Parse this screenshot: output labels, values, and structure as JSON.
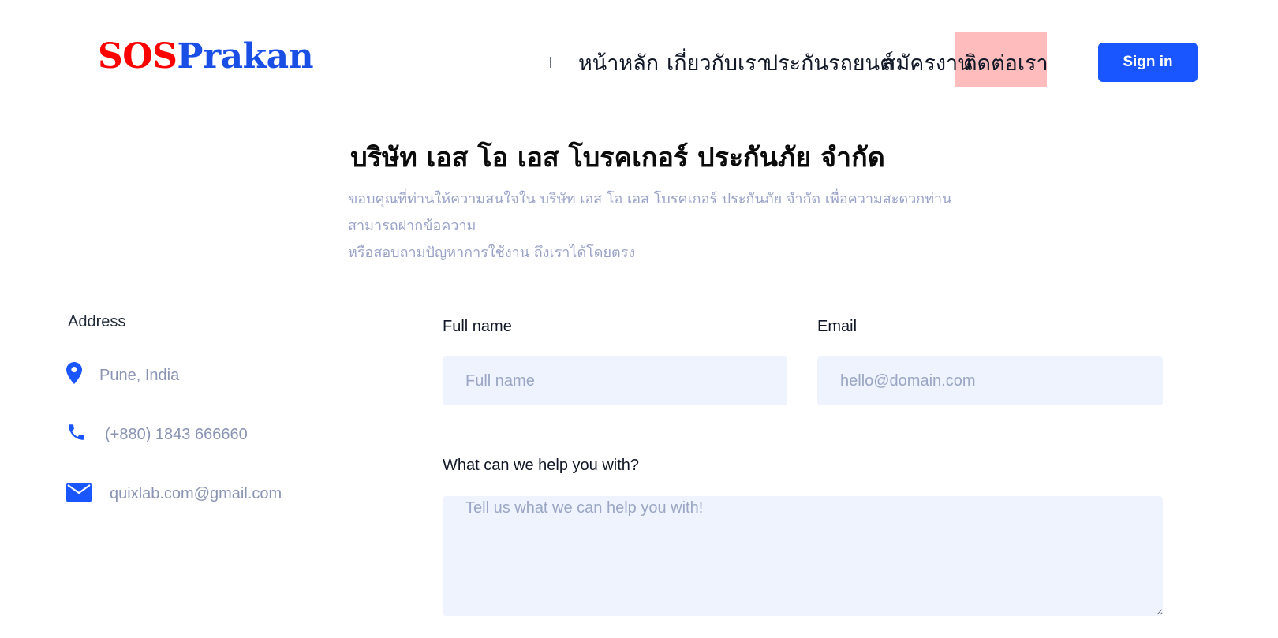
{
  "brand": {
    "part1": "SOS",
    "part2": "Prakan",
    "colors": {
      "part1": "#ff0000",
      "part2": "#1a4fe6"
    }
  },
  "nav": {
    "items": [
      {
        "label": "หน้าหลัก"
      },
      {
        "label": "เกี่ยวกับเรา"
      },
      {
        "label": "ประกันรถยนต์"
      },
      {
        "label": "สมัครงาน"
      },
      {
        "label": "ติดต่อเรา",
        "active": true
      }
    ],
    "signin_label": "Sign in",
    "accent": "#1a56ff",
    "active_highlight": "#ffbcbc"
  },
  "hero": {
    "title": "บริษัท เอส โอ เอส โบรคเกอร์ ประกันภัย จำกัด",
    "subtitle_line1": "ขอบคุณที่ท่านให้ความสนใจใน บริษัท เอส โอ เอส โบรคเกอร์ ประกันภัย จำกัด เพื่อความสะดวกท่านสามารถฝากข้อความ",
    "subtitle_line2": "หรือสอบถามปัญหาการใช้งาน ถึงเราได้โดยตรง"
  },
  "contact": {
    "address_label": "Address",
    "items": [
      {
        "icon": "map-pin-icon",
        "text": "Pune, India"
      },
      {
        "icon": "phone-icon",
        "text": "(+880) 1843 666660"
      },
      {
        "icon": "envelope-icon",
        "text": "quixlab.com@gmail.com"
      }
    ]
  },
  "form": {
    "full_name": {
      "label": "Full name",
      "placeholder": "Full name",
      "value": ""
    },
    "email": {
      "label": "Email",
      "placeholder": "hello@domain.com",
      "value": ""
    },
    "message": {
      "label": "What can we help you with?",
      "placeholder": "Tell us what we can help you with!",
      "value": ""
    }
  }
}
